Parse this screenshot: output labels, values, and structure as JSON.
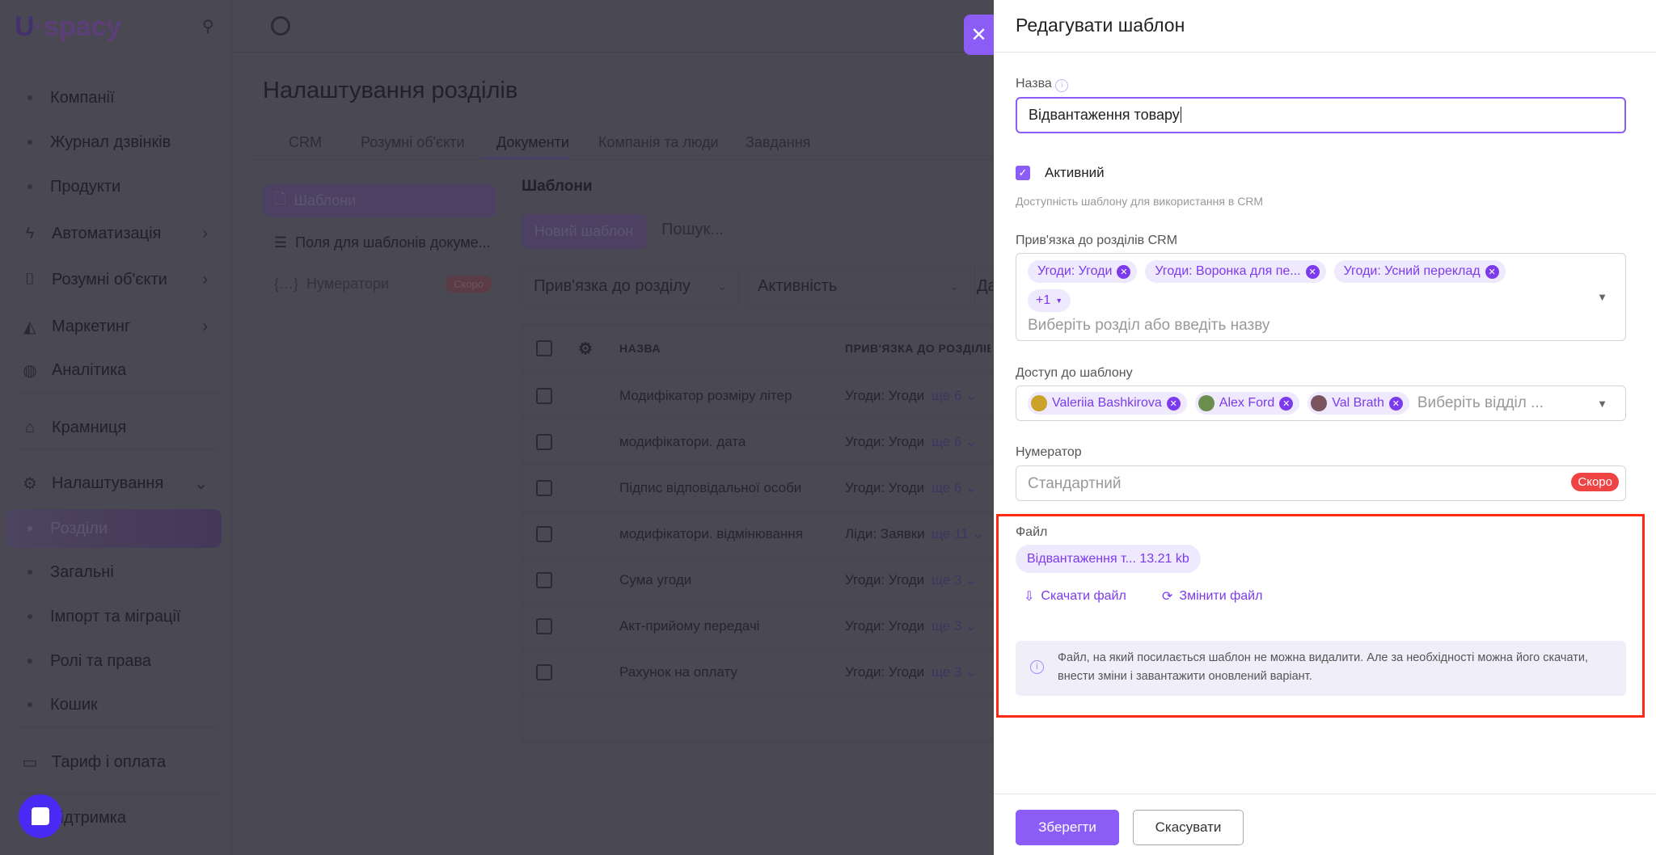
{
  "app": {
    "logo": "Uspacy"
  },
  "sidebar": {
    "items": [
      {
        "label": "Компанії"
      },
      {
        "label": "Журнал дзвінків"
      },
      {
        "label": "Продукти"
      },
      {
        "label": "Автоматизація"
      },
      {
        "label": "Розумні об'єкти"
      },
      {
        "label": "Маркетинг"
      },
      {
        "label": "Аналітика"
      },
      {
        "label": "Крамниця"
      },
      {
        "label": "Налаштування"
      },
      {
        "label": "Розділи"
      },
      {
        "label": "Загальні"
      },
      {
        "label": "Імпорт та міграції"
      },
      {
        "label": "Ролі та права"
      },
      {
        "label": "Кошик"
      },
      {
        "label": "Тариф і оплата"
      },
      {
        "label": "Підтримка"
      }
    ]
  },
  "page": {
    "title": "Налаштування розділів",
    "tabs": [
      {
        "label": "CRM"
      },
      {
        "label": "Розумні об'єкти"
      },
      {
        "label": "Документи"
      },
      {
        "label": "Компанія та люди"
      },
      {
        "label": "Завдання"
      }
    ],
    "subnav": [
      {
        "label": "Шаблони"
      },
      {
        "label": "Поля для шаблонів докуме..."
      },
      {
        "label": "Нумератори",
        "badge": "Скоро"
      }
    ],
    "section_title": "Шаблони",
    "new_button": "Новий шаблон",
    "search_placeholder": "Пошук...",
    "filters": [
      {
        "label": "Прив'язка до розділу"
      },
      {
        "label": "Активність"
      },
      {
        "label": "Да"
      }
    ],
    "table": {
      "headers": {
        "name": "НАЗВА",
        "binding": "ПРИВ'ЯЗКА ДО РОЗДІЛІВ"
      },
      "rows": [
        {
          "name": "Модифікатор розміру літер",
          "binding": "Угоди: Угоди",
          "more": "ще 6"
        },
        {
          "name": "модифікатори. дата",
          "binding": "Угоди: Угоди",
          "more": "ще 6"
        },
        {
          "name": "Підпис відповідальної особи",
          "binding": "Угоди: Угоди",
          "more": "ще 6"
        },
        {
          "name": "модифікатори. відмінювання",
          "binding": "Ліди: Заявки",
          "more": "ще 11"
        },
        {
          "name": "Сума угоди",
          "binding": "Угоди: Угоди",
          "more": "ще 3"
        },
        {
          "name": "Акт-прийому передачі",
          "binding": "Угоди: Угоди",
          "more": "ще 3"
        },
        {
          "name": "Рахунок на оплату",
          "binding": "Угоди: Угоди",
          "more": "ще 3"
        }
      ]
    }
  },
  "drawer": {
    "title": "Редагувати шаблон",
    "name_label": "Назва",
    "name_value": "Відвантаження товару",
    "active_label": "Активний",
    "active_checked": true,
    "active_hint": "Доступність шаблону для використання в CRM",
    "binding_label": "Прив'язка до розділів CRM",
    "binding_chips": [
      {
        "label": "Угоди: Угоди"
      },
      {
        "label": "Угоди: Воронка для пе..."
      },
      {
        "label": "Угоди: Усний переклад"
      }
    ],
    "binding_more": "+1",
    "binding_placeholder": "Виберіть розділ або введіть назву",
    "access_label": "Доступ до шаблону",
    "access_chips": [
      {
        "label": "Valeriia Bashkirova"
      },
      {
        "label": "Alex Ford"
      },
      {
        "label": "Val Brath"
      }
    ],
    "access_placeholder": "Виберіть відділ ...",
    "numerator_label": "Нумератор",
    "numerator_placeholder": "Стандартний",
    "numerator_badge": "Скоро",
    "file_label": "Файл",
    "file_chip": "Відвантаження т... 13.21 kb",
    "download_label": "Скачати файл",
    "change_label": "Змінити файл",
    "info_text": "Файл, на який посилається шаблон не можна видалити. Але за необхідності можна його скачати, внести зміни і завантажити оновлений варіант.",
    "save_label": "Зберегти",
    "cancel_label": "Скасувати"
  },
  "colors": {
    "accent": "#8b5cf6",
    "danger": "#ef4444",
    "highlight": "#ff2a14"
  }
}
